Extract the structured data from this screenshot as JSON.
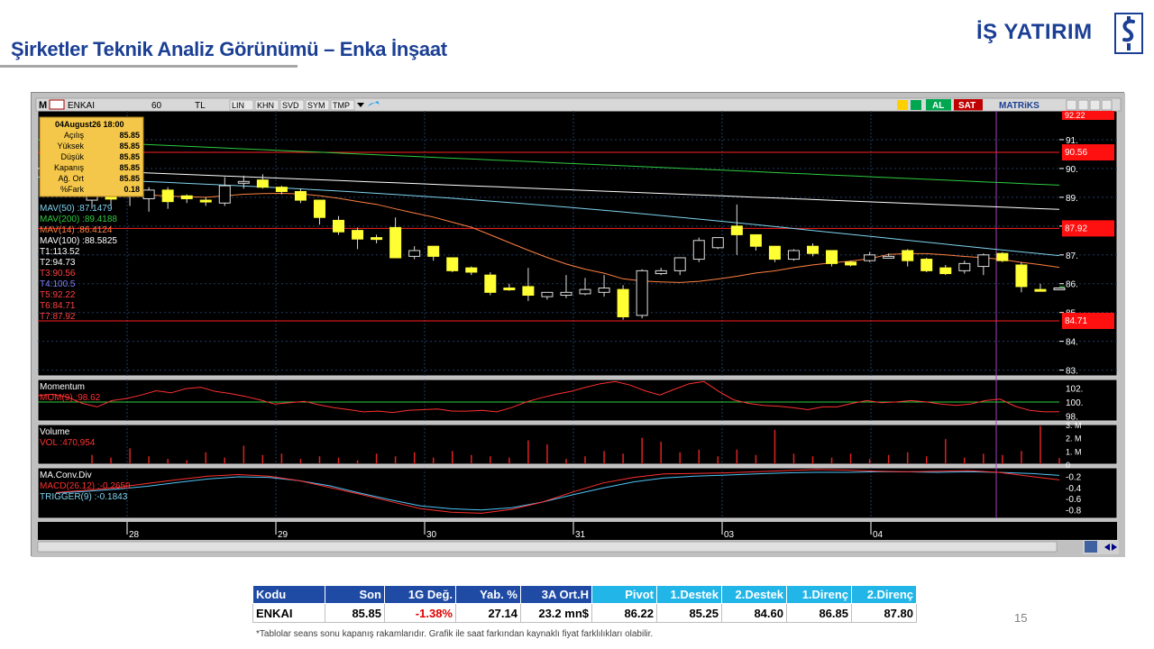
{
  "slide": {
    "title": "Şirketler Teknik Analiz Görünümü – Enka İnşaat",
    "page_number": "15",
    "footnote": "*Tablolar seans sonu kapanış rakamlarıdır. Grafik ile saat farkından kaynaklı fiyat farklılıkları olabilir."
  },
  "logo": {
    "text": "İŞ YATIRIM",
    "color": "#1b3f94"
  },
  "toolbar": {
    "symbol": "ENKAI",
    "period": "60",
    "currency": "TL",
    "buttons": [
      "LIN",
      "KHN",
      "SVD",
      "SYM",
      "TMP"
    ],
    "buy_label": "AL",
    "sell_label": "SAT",
    "brand": "MATRiKS"
  },
  "info_box": {
    "date": "04August26 18:00",
    "rows": [
      {
        "label": "Açılış",
        "value": "85.85"
      },
      {
        "label": "Yüksek",
        "value": "85.85"
      },
      {
        "label": "Düşük",
        "value": "85.85"
      },
      {
        "label": "Kapanış",
        "value": "85.85"
      },
      {
        "label": "Ağ. Ort",
        "value": "85.85"
      },
      {
        "label": "%Fark",
        "value": "0.18"
      }
    ]
  },
  "indicators": [
    {
      "name": "MAV(50)",
      "value": ":87.1479",
      "color": "#7fd4f0"
    },
    {
      "name": "MAV(200)",
      "value": ":89.4188",
      "color": "#2ecc40"
    },
    {
      "name": "MAV(14)",
      "value": ":86.4124",
      "color": "#ff8040"
    },
    {
      "name": "MAV(100)",
      "value": ":88.5825",
      "color": "#ffffff"
    },
    {
      "name": "T1",
      "value": ":113.52",
      "color": "#ffffff"
    },
    {
      "name": "T2",
      "value": ":94.73",
      "color": "#ffffff"
    },
    {
      "name": "T3",
      "value": ":90.56",
      "color": "#ff4040"
    },
    {
      "name": "T4",
      "value": ":100.5",
      "color": "#8080ff"
    },
    {
      "name": "T5",
      "value": ":92.22",
      "color": "#ff4040"
    },
    {
      "name": "T6",
      "value": ":84.71",
      "color": "#ff4040"
    },
    {
      "name": "T7",
      "value": ":87.92",
      "color": "#ff4040"
    }
  ],
  "price_axis": {
    "ticks": [
      "91.",
      "90.",
      "89.",
      "88.",
      "87.",
      "86.",
      "85.",
      "84.",
      "83."
    ],
    "min": 82.8,
    "max": 92.0
  },
  "level_tags": [
    {
      "label": "90.56",
      "value": 90.56
    },
    {
      "label": "87.92",
      "value": 87.92
    },
    {
      "label": "84.71",
      "value": 84.71
    }
  ],
  "top_tag": "92.22",
  "momentum": {
    "title": "Momentum",
    "name": "MOM(9)",
    "value": ":98.62",
    "ticks": [
      "102.",
      "100.",
      "98."
    ],
    "min": 97.3,
    "max": 103.2,
    "reference": 100
  },
  "volume": {
    "title": "Volume",
    "name": "VOL",
    "value": ":470,954",
    "ticks": [
      "3. M",
      "2. M",
      "1. M",
      "0"
    ],
    "max": 3000000
  },
  "macd": {
    "title": "MA.Conv.Div",
    "macd_name": "MACD(26.12)",
    "macd_value": ":-0.2659",
    "trigger_name": "TRIGGER(9)",
    "trigger_value": ":-0.1843",
    "ticks": [
      "-0.2",
      "-0.4",
      "-0.6",
      "-0.8"
    ],
    "min": -0.95,
    "max": -0.05
  },
  "time_axis": {
    "labels": [
      "28",
      "29",
      "30",
      "31",
      "03",
      "04"
    ]
  },
  "chart_data": {
    "type": "candlestick",
    "symbol": "ENKAI",
    "x": [
      "28",
      "29",
      "30",
      "31",
      "03",
      "04"
    ],
    "candles": [
      [
        88.9,
        89.4,
        88.6,
        89.1
      ],
      [
        89.0,
        89.1,
        88.7,
        88.95
      ],
      [
        89.2,
        89.3,
        88.7,
        89.05
      ],
      [
        88.95,
        89.35,
        88.5,
        89.25
      ],
      [
        89.25,
        89.35,
        88.6,
        88.85
      ],
      [
        89.05,
        89.1,
        88.8,
        88.95
      ],
      [
        88.9,
        89.0,
        88.7,
        88.85
      ],
      [
        88.8,
        89.7,
        88.7,
        89.4
      ],
      [
        89.5,
        89.75,
        89.3,
        89.55
      ],
      [
        89.6,
        89.8,
        89.3,
        89.35
      ],
      [
        89.35,
        89.4,
        89.1,
        89.2
      ],
      [
        89.2,
        89.3,
        88.8,
        88.9
      ],
      [
        88.9,
        88.9,
        88.05,
        88.3
      ],
      [
        88.2,
        88.35,
        87.7,
        87.8
      ],
      [
        87.85,
        87.95,
        87.2,
        87.55
      ],
      [
        87.6,
        87.7,
        87.4,
        87.55
      ],
      [
        87.95,
        88.3,
        86.9,
        86.9
      ],
      [
        86.95,
        87.3,
        86.85,
        87.15
      ],
      [
        87.3,
        87.3,
        86.8,
        86.95
      ],
      [
        86.9,
        86.9,
        86.4,
        86.45
      ],
      [
        86.55,
        86.6,
        86.3,
        86.4
      ],
      [
        86.3,
        86.4,
        85.6,
        85.7
      ],
      [
        85.85,
        86.0,
        85.75,
        85.8
      ],
      [
        85.9,
        86.55,
        85.4,
        85.6
      ],
      [
        85.55,
        85.7,
        85.45,
        85.7
      ],
      [
        85.6,
        86.3,
        85.5,
        85.7
      ],
      [
        85.65,
        86.2,
        85.6,
        85.8
      ],
      [
        85.7,
        86.3,
        85.55,
        85.85
      ],
      [
        85.8,
        85.95,
        84.75,
        84.85
      ],
      [
        84.9,
        86.5,
        84.8,
        86.45
      ],
      [
        86.35,
        86.55,
        86.3,
        86.45
      ],
      [
        86.45,
        86.9,
        86.3,
        86.9
      ],
      [
        86.85,
        87.6,
        86.75,
        87.5
      ],
      [
        87.25,
        87.6,
        87.2,
        87.6
      ],
      [
        88.0,
        88.75,
        87.0,
        87.7
      ],
      [
        87.7,
        87.7,
        87.15,
        87.3
      ],
      [
        87.3,
        87.3,
        86.75,
        86.85
      ],
      [
        86.85,
        87.2,
        86.8,
        87.15
      ],
      [
        87.3,
        87.4,
        86.95,
        87.05
      ],
      [
        87.15,
        87.15,
        86.6,
        86.7
      ],
      [
        86.75,
        86.8,
        86.6,
        86.65
      ],
      [
        86.8,
        87.1,
        86.75,
        87.0
      ],
      [
        86.95,
        87.05,
        86.9,
        86.95
      ],
      [
        87.15,
        87.2,
        86.6,
        86.8
      ],
      [
        86.85,
        86.9,
        86.4,
        86.45
      ],
      [
        86.55,
        86.65,
        86.3,
        86.35
      ],
      [
        86.45,
        86.8,
        86.35,
        86.7
      ],
      [
        86.6,
        87.05,
        86.3,
        87.0
      ],
      [
        87.05,
        87.1,
        86.75,
        86.8
      ],
      [
        86.65,
        86.75,
        85.7,
        85.9
      ],
      [
        85.8,
        86.0,
        85.75,
        85.75
      ],
      [
        85.85,
        85.85,
        85.85,
        85.85
      ]
    ],
    "ma_periods": [
      14,
      50,
      100,
      200
    ],
    "ma_values_start_end": {
      "MAV(14)": [
        89.2,
        86.41
      ],
      "MAV(50)": [
        89.7,
        87.15
      ],
      "MAV(100)": [
        90.0,
        88.58
      ],
      "MAV(200)": [
        91.0,
        89.42
      ]
    },
    "horizontal_levels": [
      90.56,
      87.92,
      84.71
    ],
    "volume_values": [
      700000,
      500000,
      1200000,
      600000,
      400000,
      300000,
      900000,
      500000,
      1400000,
      700000,
      800000,
      400000,
      600000,
      500000,
      300000,
      800000,
      600000,
      900000,
      500000,
      1000000,
      700000,
      600000,
      500000,
      1800000,
      1500000,
      400000,
      600000,
      1000000,
      800000,
      2000000,
      1700000,
      900000,
      1100000,
      600000,
      1100000,
      700000,
      2600000,
      800000,
      600000,
      500000,
      800000,
      400000,
      700000,
      900000,
      600000,
      1900000,
      500000,
      800000,
      700000,
      1000000,
      2900000,
      470954
    ],
    "momentum_values": [
      100.9,
      101.1,
      100.7,
      99.8,
      99.3,
      100.2,
      100.5,
      101.0,
      101.6,
      101.3,
      101.9,
      102.1,
      101.5,
      101.2,
      100.8,
      100.3,
      99.7,
      99.9,
      100.1,
      99.6,
      99.2,
      98.9,
      98.6,
      98.7,
      98.5,
      98.8,
      98.9,
      99.0,
      98.7,
      98.7,
      98.8,
      98.6,
      99.2,
      100.0,
      100.6,
      101.1,
      101.5,
      102.1,
      102.6,
      102.9,
      102.4,
      101.6,
      101.0,
      101.8,
      102.6,
      102.9,
      101.5,
      100.3,
      99.8,
      99.5,
      99.4,
      99.2,
      98.9,
      99.3,
      99.3,
      99.8,
      100.2,
      99.9,
      100.0,
      100.2,
      100.0,
      99.7,
      99.5,
      99.7,
      100.2,
      100.4,
      99.4,
      98.8,
      98.6,
      98.62
    ],
    "macd_values": [
      -0.49,
      -0.45,
      -0.4,
      -0.33,
      -0.26,
      -0.2,
      -0.17,
      -0.2,
      -0.28,
      -0.4,
      -0.52,
      -0.65,
      -0.78,
      -0.84,
      -0.86,
      -0.79,
      -0.66,
      -0.48,
      -0.32,
      -0.22,
      -0.16,
      -0.15,
      -0.14,
      -0.12,
      -0.1,
      -0.08,
      -0.09,
      -0.11,
      -0.12,
      -0.11,
      -0.1,
      -0.13,
      -0.2,
      -0.2659
    ],
    "trigger_values": [
      -0.5,
      -0.47,
      -0.43,
      -0.38,
      -0.31,
      -0.25,
      -0.21,
      -0.22,
      -0.28,
      -0.37,
      -0.5,
      -0.62,
      -0.73,
      -0.78,
      -0.8,
      -0.76,
      -0.66,
      -0.53,
      -0.41,
      -0.3,
      -0.23,
      -0.2,
      -0.18,
      -0.16,
      -0.14,
      -0.13,
      -0.13,
      -0.12,
      -0.12,
      -0.13,
      -0.12,
      -0.13,
      -0.15,
      -0.1843
    ]
  },
  "summary_table": {
    "headers": [
      "Kodu",
      "Son",
      "1G Değ.",
      "Yab. %",
      "3A Ort.H",
      "Pivot",
      "1.Destek",
      "2.Destek",
      "1.Direnç",
      "2.Direnç"
    ],
    "row": [
      "ENKAI",
      "85.85",
      "-1.38%",
      "27.14",
      "23.2 mn$",
      "86.22",
      "85.25",
      "84.60",
      "86.85",
      "87.80"
    ]
  },
  "colors": {
    "background": "#000000",
    "candle": "#ffff33",
    "grid": "#1f3a5f",
    "level": "#ff2020",
    "volume": "#dd2222",
    "macd": "#ff3030",
    "trigger": "#4fc3f7",
    "brand_blue": "#1f4ba5",
    "header_cyan": "#22b5e8"
  }
}
